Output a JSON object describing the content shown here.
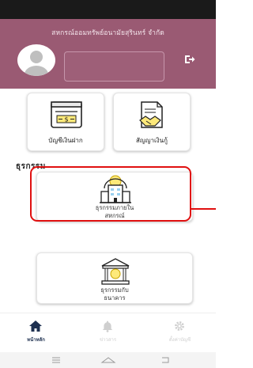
{
  "header": {
    "title": "สหกรณ์ออมทรัพย์อนามัยสุรินทร์ จำกัด",
    "name_value": ""
  },
  "cards": {
    "deposit_label": "บัญชีเงินฝาก",
    "loan_label": "สัญญาเงินกู้"
  },
  "section": {
    "title": "ธุรกรรม"
  },
  "transactions": {
    "internal_line1": "ธุรกรรมภายใน",
    "internal_line2": "สหกรณ์",
    "bank_line1": "ธุรกรรมกับ",
    "bank_line2": "ธนาคาร"
  },
  "nav": {
    "home": "หน้าหลัก",
    "news": "ข่าวสาร",
    "settings": "ตั้งค่าบัญชี"
  },
  "colors": {
    "header": "#9a5a73",
    "highlight": "#e01010",
    "nav_active": "#1e3050"
  }
}
